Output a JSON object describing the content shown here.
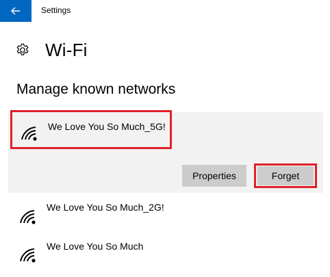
{
  "titlebar": {
    "back_icon": "back-arrow-icon",
    "app_name": "Settings",
    "accent": "#0067c0"
  },
  "header": {
    "icon": "gear-icon",
    "title": "Wi-Fi"
  },
  "section": {
    "title": "Manage known networks"
  },
  "networks": [
    {
      "name": "We Love You So Much_5G!",
      "icon": "wifi-secured-icon",
      "selected": true
    },
    {
      "name": "We Love You So Much_2G!",
      "icon": "wifi-secured-icon",
      "selected": false
    },
    {
      "name": "We Love You So Much",
      "icon": "wifi-secured-icon",
      "selected": false
    }
  ],
  "actions": {
    "properties_label": "Properties",
    "forget_label": "Forget"
  },
  "colors": {
    "highlight_red": "#e0202a",
    "panel_bg": "#f2f2f2",
    "button_bg": "#cccccc"
  }
}
